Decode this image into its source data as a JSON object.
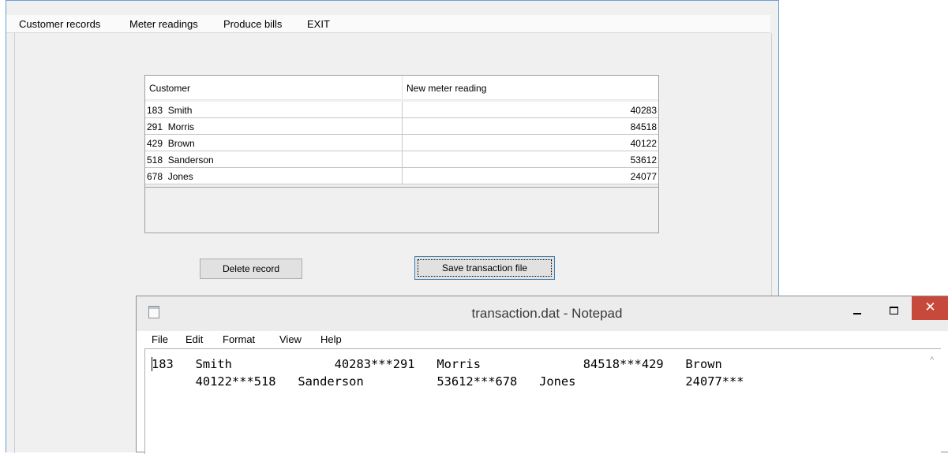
{
  "app": {
    "menu": [
      "Customer records",
      "Meter readings",
      "Produce bills",
      "EXIT"
    ],
    "grid": {
      "columns": [
        "Customer",
        "New meter reading"
      ],
      "rows": [
        {
          "customer": "183  Smith",
          "reading": "40283"
        },
        {
          "customer": "291  Morris",
          "reading": "84518"
        },
        {
          "customer": "429  Brown",
          "reading": "40122"
        },
        {
          "customer": "518  Sanderson",
          "reading": "53612"
        },
        {
          "customer": "678  Jones",
          "reading": "24077"
        }
      ]
    },
    "buttons": {
      "delete": "Delete record",
      "save": "Save transaction file"
    }
  },
  "notepad": {
    "title": "transaction.dat - Notepad",
    "menu": [
      "File",
      "Edit",
      "Format",
      "View",
      "Help"
    ],
    "lines": [
      "183   Smith              40283***291   Morris              84518***429   Brown",
      "      40122***518   Sanderson          53612***678   Jones               24077***"
    ],
    "controls": {
      "minimize": "minimize-icon",
      "maximize": "maximize-icon",
      "close": "close-icon"
    }
  }
}
